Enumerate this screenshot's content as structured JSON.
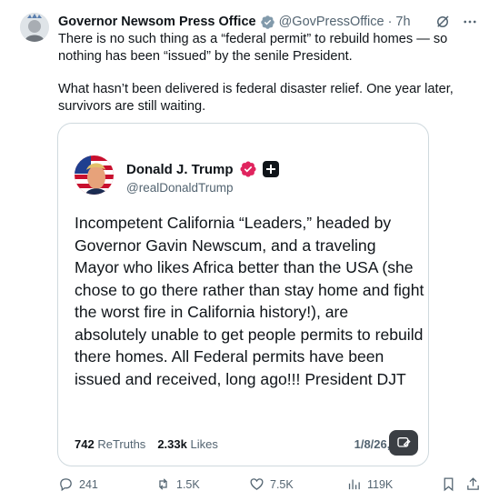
{
  "post": {
    "author_name": "Governor Newsom Press Office",
    "handle": "@GovPressOffice",
    "separator": "·",
    "time": "7h",
    "paragraphs": [
      "There is no such thing as a “federal permit” to rebuild homes — so nothing has been “issued” by the senile President.",
      "What hasn’t been delivered is federal disaster relief. One year later, survivors are still waiting."
    ],
    "icons": {
      "verified": "verified-badge-icon",
      "grok": "grok-icon",
      "more": "more-icon"
    }
  },
  "quote": {
    "author_name": "Donald J. Trump",
    "handle": "@realDonaldTrump",
    "text": "Incompetent California “Leaders,” headed by Governor Gavin Newscum, and a traveling Mayor who likes Africa better than the USA (she chose to go there rather than stay home and fight the worst fire in California history!), are absolutely unable to get people permits to rebuild there homes. All Federal permits have been issued and received, long ago!!! President DJT",
    "retruths_count": "742",
    "retruths_label": "ReTruths",
    "likes_count": "2.33k",
    "likes_label": "Likes",
    "date": "1/8/26, 5:59"
  },
  "actions": {
    "replies": "241",
    "reposts": "1.5K",
    "likes": "7.5K",
    "views": "119K"
  },
  "colors": {
    "text": "#0f1419",
    "muted": "#536471",
    "border": "#cfd9de",
    "verified_blue": "#1d9bf0",
    "truth_badge": "#e0245e"
  }
}
